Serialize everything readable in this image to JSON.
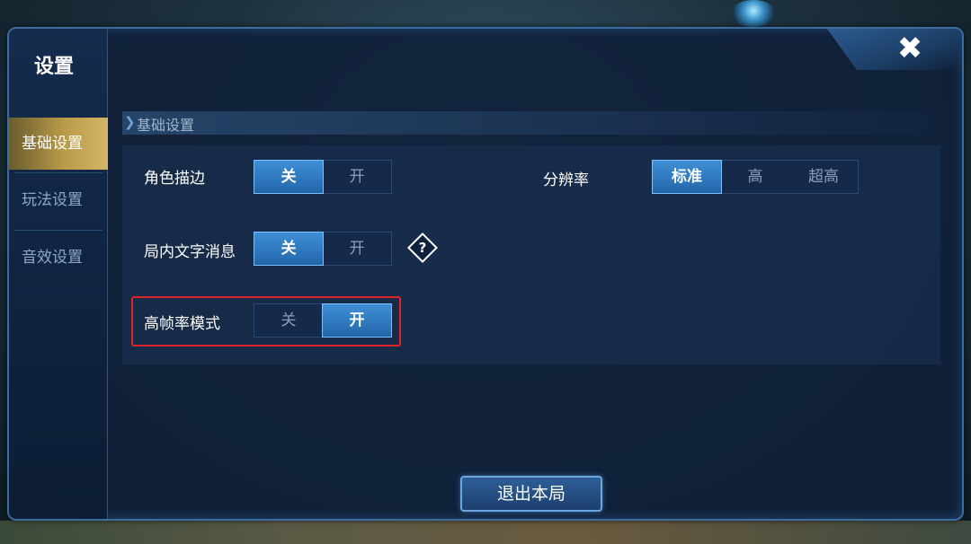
{
  "panel": {
    "title": "设置",
    "close_label": "✖"
  },
  "sidebar": {
    "tabs": [
      {
        "label": "基础设置",
        "active": true
      },
      {
        "label": "玩法设置",
        "active": false
      },
      {
        "label": "音效设置",
        "active": false
      }
    ]
  },
  "section": {
    "title": "基础设置"
  },
  "settings": {
    "outline": {
      "label": "角色描边",
      "options": [
        "关",
        "开"
      ],
      "selected": "关"
    },
    "in_game_text": {
      "label": "局内文字消息",
      "options": [
        "关",
        "开"
      ],
      "selected": "关",
      "help_label": "?"
    },
    "high_fps": {
      "label": "高帧率模式",
      "options": [
        "关",
        "开"
      ],
      "selected": "开"
    },
    "resolution": {
      "label": "分辨率",
      "options": [
        "标准",
        "高",
        "超高"
      ],
      "selected": "标准"
    }
  },
  "footer": {
    "exit_label": "退出本局"
  },
  "colors": {
    "accent_selected": "#2f7cc6",
    "highlight_border": "#e0242a",
    "active_tab_gold": "#b89a48"
  }
}
